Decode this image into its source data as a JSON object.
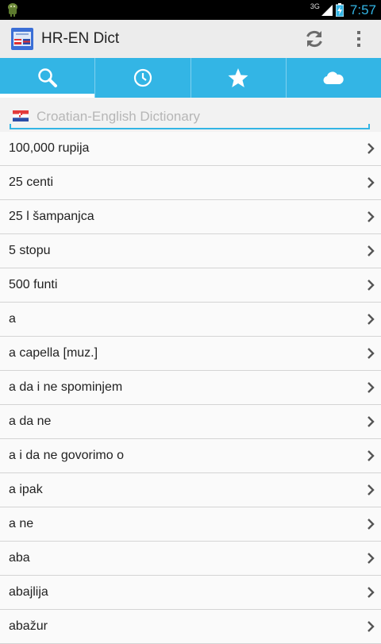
{
  "status_bar": {
    "network": "3G",
    "time": "7:57"
  },
  "app": {
    "title": "HR-EN Dict",
    "icon": "app-dictionary-icon"
  },
  "action_bar": {
    "actions": [
      {
        "name": "sync-icon"
      },
      {
        "name": "overflow-menu-icon"
      }
    ]
  },
  "tabs": [
    {
      "icon": "search-icon",
      "active": true
    },
    {
      "icon": "history-clock-icon",
      "active": false
    },
    {
      "icon": "favorites-star-icon",
      "active": false
    },
    {
      "icon": "cloud-icon",
      "active": false
    }
  ],
  "search": {
    "placeholder": "Croatian-English Dictionary",
    "value": ""
  },
  "entries": [
    "100,000 rupija",
    "25 centi",
    "25 l šampanjca",
    "5 stopu",
    "500 funti",
    "a",
    "a capella [muz.]",
    "a da i ne spominjem",
    "a da ne",
    "a i da ne govorimo o",
    "a ipak",
    "a ne",
    "aba",
    "abajlija",
    "abažur"
  ],
  "colors": {
    "accent": "#33b5e5",
    "actionbar": "#ececec",
    "statusbar": "#000000"
  }
}
